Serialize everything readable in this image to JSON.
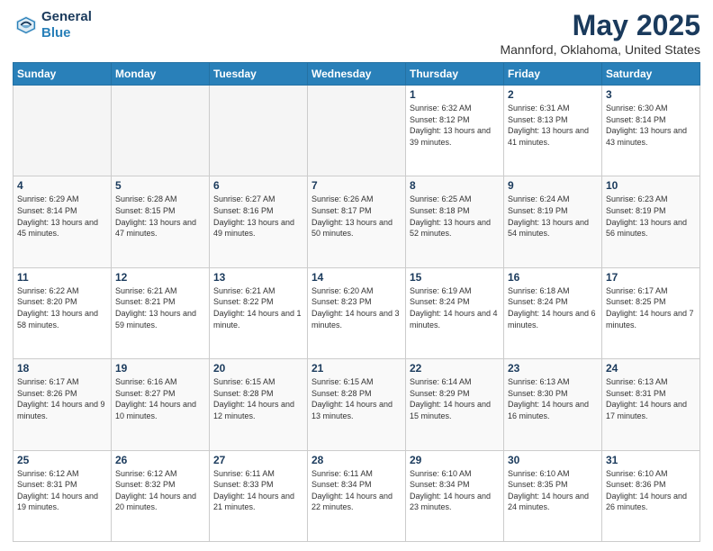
{
  "header": {
    "logo_line1": "General",
    "logo_line2": "Blue",
    "month_title": "May 2025",
    "location": "Mannford, Oklahoma, United States"
  },
  "weekdays": [
    "Sunday",
    "Monday",
    "Tuesday",
    "Wednesday",
    "Thursday",
    "Friday",
    "Saturday"
  ],
  "weeks": [
    [
      {
        "day": "",
        "sunrise": "",
        "sunset": "",
        "daylight": ""
      },
      {
        "day": "",
        "sunrise": "",
        "sunset": "",
        "daylight": ""
      },
      {
        "day": "",
        "sunrise": "",
        "sunset": "",
        "daylight": ""
      },
      {
        "day": "",
        "sunrise": "",
        "sunset": "",
        "daylight": ""
      },
      {
        "day": "1",
        "sunrise": "Sunrise: 6:32 AM",
        "sunset": "Sunset: 8:12 PM",
        "daylight": "Daylight: 13 hours and 39 minutes."
      },
      {
        "day": "2",
        "sunrise": "Sunrise: 6:31 AM",
        "sunset": "Sunset: 8:13 PM",
        "daylight": "Daylight: 13 hours and 41 minutes."
      },
      {
        "day": "3",
        "sunrise": "Sunrise: 6:30 AM",
        "sunset": "Sunset: 8:14 PM",
        "daylight": "Daylight: 13 hours and 43 minutes."
      }
    ],
    [
      {
        "day": "4",
        "sunrise": "Sunrise: 6:29 AM",
        "sunset": "Sunset: 8:14 PM",
        "daylight": "Daylight: 13 hours and 45 minutes."
      },
      {
        "day": "5",
        "sunrise": "Sunrise: 6:28 AM",
        "sunset": "Sunset: 8:15 PM",
        "daylight": "Daylight: 13 hours and 47 minutes."
      },
      {
        "day": "6",
        "sunrise": "Sunrise: 6:27 AM",
        "sunset": "Sunset: 8:16 PM",
        "daylight": "Daylight: 13 hours and 49 minutes."
      },
      {
        "day": "7",
        "sunrise": "Sunrise: 6:26 AM",
        "sunset": "Sunset: 8:17 PM",
        "daylight": "Daylight: 13 hours and 50 minutes."
      },
      {
        "day": "8",
        "sunrise": "Sunrise: 6:25 AM",
        "sunset": "Sunset: 8:18 PM",
        "daylight": "Daylight: 13 hours and 52 minutes."
      },
      {
        "day": "9",
        "sunrise": "Sunrise: 6:24 AM",
        "sunset": "Sunset: 8:19 PM",
        "daylight": "Daylight: 13 hours and 54 minutes."
      },
      {
        "day": "10",
        "sunrise": "Sunrise: 6:23 AM",
        "sunset": "Sunset: 8:19 PM",
        "daylight": "Daylight: 13 hours and 56 minutes."
      }
    ],
    [
      {
        "day": "11",
        "sunrise": "Sunrise: 6:22 AM",
        "sunset": "Sunset: 8:20 PM",
        "daylight": "Daylight: 13 hours and 58 minutes."
      },
      {
        "day": "12",
        "sunrise": "Sunrise: 6:21 AM",
        "sunset": "Sunset: 8:21 PM",
        "daylight": "Daylight: 13 hours and 59 minutes."
      },
      {
        "day": "13",
        "sunrise": "Sunrise: 6:21 AM",
        "sunset": "Sunset: 8:22 PM",
        "daylight": "Daylight: 14 hours and 1 minute."
      },
      {
        "day": "14",
        "sunrise": "Sunrise: 6:20 AM",
        "sunset": "Sunset: 8:23 PM",
        "daylight": "Daylight: 14 hours and 3 minutes."
      },
      {
        "day": "15",
        "sunrise": "Sunrise: 6:19 AM",
        "sunset": "Sunset: 8:24 PM",
        "daylight": "Daylight: 14 hours and 4 minutes."
      },
      {
        "day": "16",
        "sunrise": "Sunrise: 6:18 AM",
        "sunset": "Sunset: 8:24 PM",
        "daylight": "Daylight: 14 hours and 6 minutes."
      },
      {
        "day": "17",
        "sunrise": "Sunrise: 6:17 AM",
        "sunset": "Sunset: 8:25 PM",
        "daylight": "Daylight: 14 hours and 7 minutes."
      }
    ],
    [
      {
        "day": "18",
        "sunrise": "Sunrise: 6:17 AM",
        "sunset": "Sunset: 8:26 PM",
        "daylight": "Daylight: 14 hours and 9 minutes."
      },
      {
        "day": "19",
        "sunrise": "Sunrise: 6:16 AM",
        "sunset": "Sunset: 8:27 PM",
        "daylight": "Daylight: 14 hours and 10 minutes."
      },
      {
        "day": "20",
        "sunrise": "Sunrise: 6:15 AM",
        "sunset": "Sunset: 8:28 PM",
        "daylight": "Daylight: 14 hours and 12 minutes."
      },
      {
        "day": "21",
        "sunrise": "Sunrise: 6:15 AM",
        "sunset": "Sunset: 8:28 PM",
        "daylight": "Daylight: 14 hours and 13 minutes."
      },
      {
        "day": "22",
        "sunrise": "Sunrise: 6:14 AM",
        "sunset": "Sunset: 8:29 PM",
        "daylight": "Daylight: 14 hours and 15 minutes."
      },
      {
        "day": "23",
        "sunrise": "Sunrise: 6:13 AM",
        "sunset": "Sunset: 8:30 PM",
        "daylight": "Daylight: 14 hours and 16 minutes."
      },
      {
        "day": "24",
        "sunrise": "Sunrise: 6:13 AM",
        "sunset": "Sunset: 8:31 PM",
        "daylight": "Daylight: 14 hours and 17 minutes."
      }
    ],
    [
      {
        "day": "25",
        "sunrise": "Sunrise: 6:12 AM",
        "sunset": "Sunset: 8:31 PM",
        "daylight": "Daylight: 14 hours and 19 minutes."
      },
      {
        "day": "26",
        "sunrise": "Sunrise: 6:12 AM",
        "sunset": "Sunset: 8:32 PM",
        "daylight": "Daylight: 14 hours and 20 minutes."
      },
      {
        "day": "27",
        "sunrise": "Sunrise: 6:11 AM",
        "sunset": "Sunset: 8:33 PM",
        "daylight": "Daylight: 14 hours and 21 minutes."
      },
      {
        "day": "28",
        "sunrise": "Sunrise: 6:11 AM",
        "sunset": "Sunset: 8:34 PM",
        "daylight": "Daylight: 14 hours and 22 minutes."
      },
      {
        "day": "29",
        "sunrise": "Sunrise: 6:10 AM",
        "sunset": "Sunset: 8:34 PM",
        "daylight": "Daylight: 14 hours and 23 minutes."
      },
      {
        "day": "30",
        "sunrise": "Sunrise: 6:10 AM",
        "sunset": "Sunset: 8:35 PM",
        "daylight": "Daylight: 14 hours and 24 minutes."
      },
      {
        "day": "31",
        "sunrise": "Sunrise: 6:10 AM",
        "sunset": "Sunset: 8:36 PM",
        "daylight": "Daylight: 14 hours and 26 minutes."
      }
    ]
  ]
}
